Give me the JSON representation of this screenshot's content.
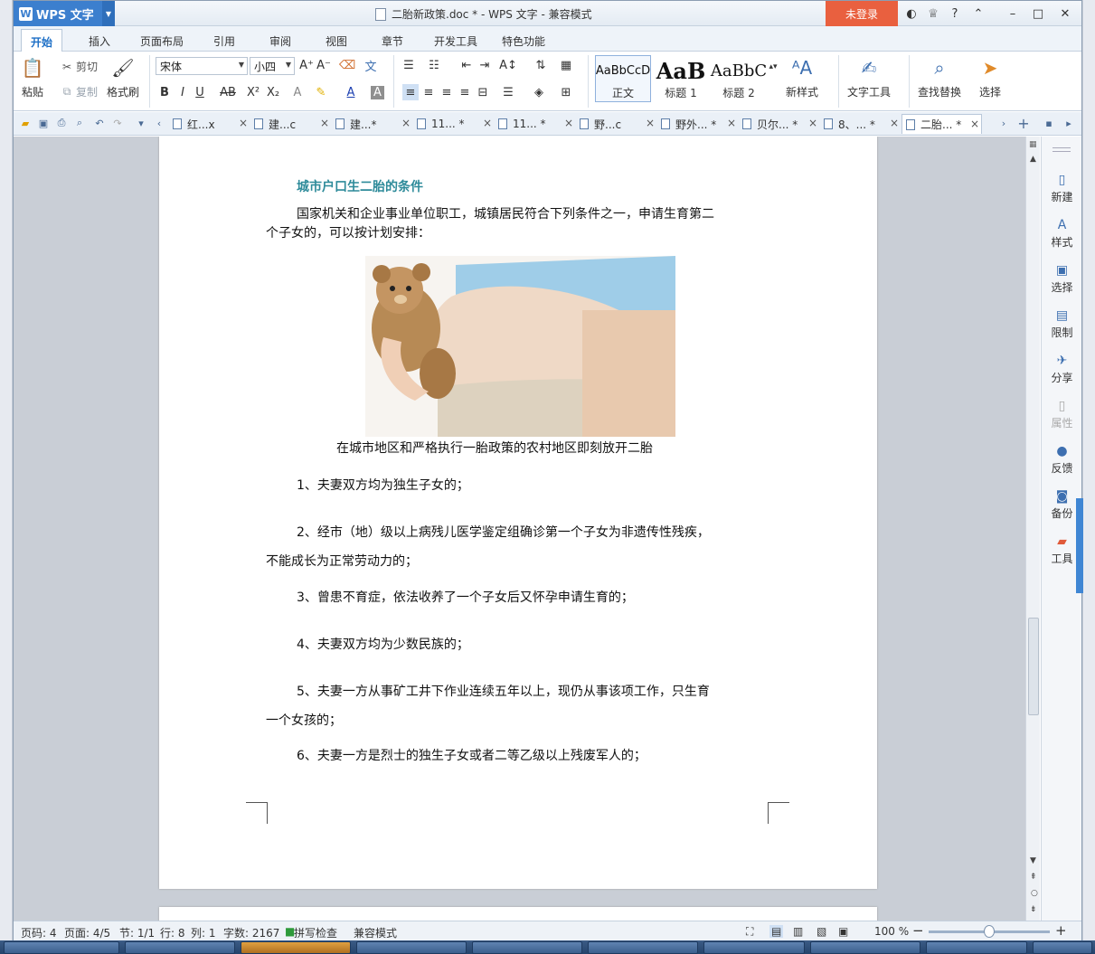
{
  "titlebar": {
    "app_name": "WPS 文字",
    "window_title": "二胎新政策.doc * - WPS 文字 - 兼容模式",
    "login": "未登录"
  },
  "menu_tabs": [
    "开始",
    "插入",
    "页面布局",
    "引用",
    "审阅",
    "视图",
    "章节",
    "开发工具",
    "特色功能"
  ],
  "ribbon": {
    "paste": "粘贴",
    "cut": "剪切",
    "copy": "复制",
    "format_painter": "格式刷",
    "font_name": "宋体",
    "font_size": "小四",
    "styles": [
      {
        "sample": "AaBbCcD",
        "name": "正文"
      },
      {
        "sample": "AaB",
        "name": "标题 1"
      },
      {
        "sample": "AaBbC",
        "name": "标题 2"
      }
    ],
    "new_style": "新样式",
    "text_tools": "文字工具",
    "find_replace": "查找替换",
    "select": "选择"
  },
  "doc_tabs": [
    "红...x",
    "建...c",
    "建...*",
    "11... *",
    "11... *",
    "野...c",
    "野外... *",
    "贝尔... *",
    "8、... *",
    "二胎... *"
  ],
  "document": {
    "heading": "城市户口生二胎的条件",
    "intro_line1": "国家机关和企业事业单位职工，城镇居民符合下列条件之一，申请生育第二",
    "intro_line2": "个子女的，可以按计划安排：",
    "caption": "在城市地区和严格执行一胎政策的农村地区即刻放开二胎",
    "items": [
      {
        "line1": "1、夫妻双方均为独生子女的；",
        "line2": ""
      },
      {
        "line1": "2、经市（地）级以上病残儿医学鉴定组确诊第一个子女为非遗传性残疾，",
        "line2": "不能成长为正常劳动力的；"
      },
      {
        "line1": "3、曾患不育症，依法收养了一个子女后又怀孕申请生育的；",
        "line2": ""
      },
      {
        "line1": "4、夫妻双方均为少数民族的；",
        "line2": ""
      },
      {
        "line1": "5、夫妻一方从事矿工井下作业连续五年以上，现仍从事该项工作，只生育",
        "line2": "一个女孩的；"
      },
      {
        "line1": "6、夫妻一方是烈士的独生子女或者二等乙级以上残废军人的；",
        "line2": ""
      }
    ]
  },
  "side_panel": [
    "新建",
    "样式",
    "选择",
    "限制",
    "分享",
    "属性",
    "反馈",
    "备份",
    "工具"
  ],
  "status": {
    "page_code": "页码: 4",
    "page": "页面: 4/5",
    "section": "节: 1/1",
    "row": "行: 8",
    "col": "列: 1",
    "word_count": "字数: 2167",
    "spell_check": "拼写检查",
    "compat": "兼容模式",
    "zoom": "100 %"
  }
}
